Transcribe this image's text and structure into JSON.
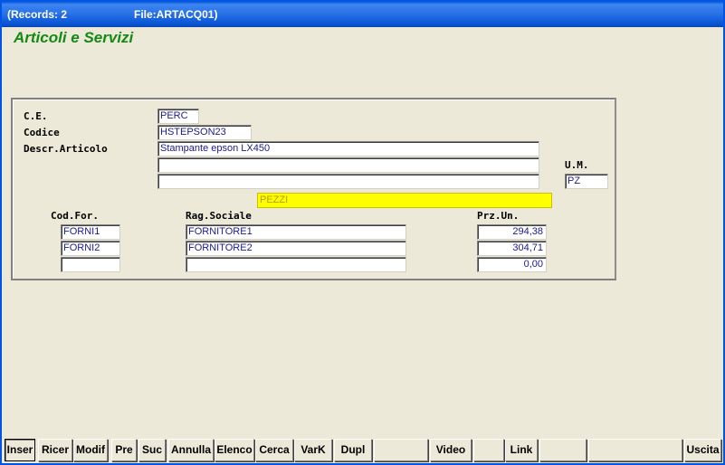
{
  "titlebar": {
    "records": "(Records: 2",
    "file": "File:ARTACQ01)"
  },
  "app_title": "Articoli e Servizi",
  "labels": {
    "ce": "C.E.",
    "codice": "Codice",
    "descr": "Descr.Articolo",
    "um": "U.M.",
    "cod_for": "Cod.For.",
    "rag_sociale": "Rag.Sociale",
    "prz_un": "Prz.Un."
  },
  "fields": {
    "ce": "PERC",
    "codice": "HSTEPSON23",
    "descr1": "Stampante epson  LX450",
    "descr2": "",
    "descr3": "",
    "um": "PZ",
    "um_descr": "PEZZI"
  },
  "suppliers": [
    {
      "cod": "FORNI1",
      "rag": "FORNITORE1",
      "prz": "294,38"
    },
    {
      "cod": "FORNI2",
      "rag": "FORNITORE2",
      "prz": "304,71"
    },
    {
      "cod": "",
      "rag": "",
      "prz": "0,00"
    }
  ],
  "toolbar": {
    "inser": "Inser",
    "ricer": "Ricer",
    "modif": "Modif",
    "pre": "Pre",
    "suc": "Suc",
    "annulla": "Annulla",
    "elenco": "Elenco",
    "cerca": "Cerca",
    "vark": "VarK",
    "dupl": "Dupl",
    "video": "Video",
    "link": "Link",
    "uscita": "Uscita"
  }
}
